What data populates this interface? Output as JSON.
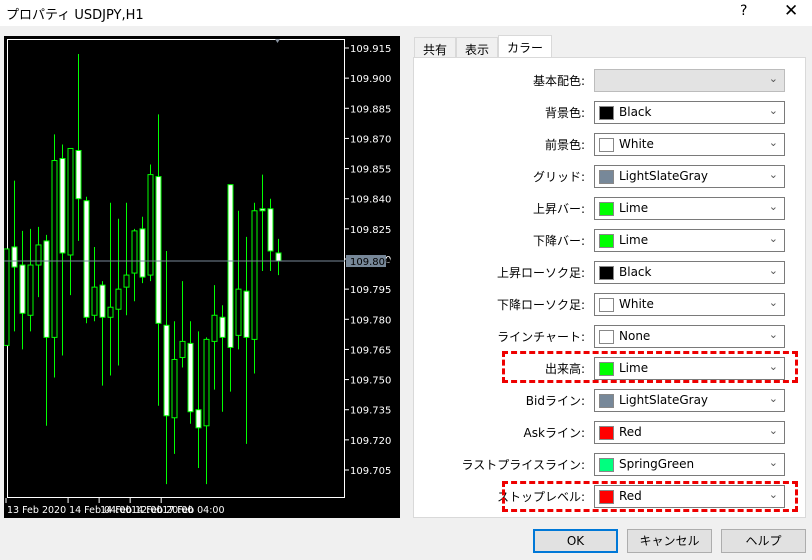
{
  "window": {
    "title": "プロパティ USDJPY,H1",
    "help_label": "?",
    "close_label": "✕"
  },
  "tabs": [
    {
      "label": "共有"
    },
    {
      "label": "表示"
    },
    {
      "label": "カラー",
      "active": true
    }
  ],
  "colors": {
    "rows": [
      {
        "label": "基本配色:",
        "value": "",
        "swatch": null,
        "disabled": true
      },
      {
        "label": "背景色:",
        "value": "Black",
        "swatch": "#000000"
      },
      {
        "label": "前景色:",
        "value": "White",
        "swatch": "#ffffff"
      },
      {
        "label": "グリッド:",
        "value": "LightSlateGray",
        "swatch": "#778899"
      },
      {
        "label": "上昇バー:",
        "value": "Lime",
        "swatch": "#00ff00"
      },
      {
        "label": "下降バー:",
        "value": "Lime",
        "swatch": "#00ff00"
      },
      {
        "label": "上昇ローソク足:",
        "value": "Black",
        "swatch": "#000000"
      },
      {
        "label": "下降ローソク足:",
        "value": "White",
        "swatch": "#ffffff"
      },
      {
        "label": "ラインチャート:",
        "value": "None",
        "swatch": "#ffffff"
      },
      {
        "label": "出来高:",
        "value": "Lime",
        "swatch": "#00ff00",
        "highlighted": true
      },
      {
        "label": "Bidライン:",
        "value": "LightSlateGray",
        "swatch": "#778899"
      },
      {
        "label": "Askライン:",
        "value": "Red",
        "swatch": "#ff0000"
      },
      {
        "label": "ラストプライスライン:",
        "value": "SpringGreen",
        "swatch": "#00ff7f"
      },
      {
        "label": "ストップレベル:",
        "value": "Red",
        "swatch": "#ff0000",
        "highlighted": true
      }
    ]
  },
  "buttons": {
    "ok": "OK",
    "cancel": "キャンセル",
    "help": "ヘルプ"
  },
  "chart_data": {
    "type": "candlestick",
    "symbol": "USDJPY",
    "timeframe": "H1",
    "ylim": [
      109.6975,
      109.9165
    ],
    "y_ticks": [
      "109.915",
      "109.900",
      "109.885",
      "109.870",
      "109.855",
      "109.840",
      "109.825",
      "109.810",
      "109.795",
      "109.780",
      "109.765",
      "109.750",
      "109.735",
      "109.720",
      "109.705"
    ],
    "x_ticks": [
      {
        "label": "13 Feb 2020",
        "index": 0
      },
      {
        "label": "14 Feb 04:00",
        "index": 16
      },
      {
        "label": "14 Feb 12:00",
        "index": 24
      },
      {
        "label": "14 Feb 20:00",
        "index": 32
      },
      {
        "label": "17 Feb 04:00",
        "index": 40
      }
    ],
    "current_price": "109.809",
    "colors": {
      "bar": "#00ff00",
      "bull_body": "#000000",
      "bear_body": "#ffffff",
      "bid_line": "#778899",
      "foreground": "#ffffff"
    },
    "ohlc": [
      [
        109.767,
        109.815,
        109.767,
        109.815
      ],
      [
        109.816,
        109.849,
        109.774,
        109.806
      ],
      [
        109.807,
        109.824,
        109.765,
        109.783
      ],
      [
        109.782,
        109.825,
        109.774,
        109.807
      ],
      [
        109.807,
        109.826,
        109.791,
        109.817
      ],
      [
        109.819,
        109.822,
        109.727,
        109.771
      ],
      [
        109.771,
        109.872,
        109.751,
        109.859
      ],
      [
        109.86,
        109.867,
        109.762,
        109.813
      ],
      [
        109.812,
        109.865,
        109.792,
        109.865
      ],
      [
        109.864,
        109.912,
        109.819,
        109.84
      ],
      [
        109.839,
        109.841,
        109.778,
        109.781
      ],
      [
        109.782,
        109.816,
        109.779,
        109.796
      ],
      [
        109.797,
        109.799,
        109.747,
        109.781
      ],
      [
        109.781,
        109.838,
        109.752,
        109.786
      ],
      [
        109.785,
        109.83,
        109.757,
        109.795
      ],
      [
        109.796,
        109.838,
        109.782,
        109.802
      ],
      [
        109.803,
        109.825,
        109.789,
        109.824
      ],
      [
        109.825,
        109.831,
        109.798,
        109.801
      ],
      [
        109.802,
        109.857,
        109.799,
        109.852
      ],
      [
        109.851,
        109.882,
        109.737,
        109.778
      ],
      [
        109.777,
        109.814,
        109.698,
        109.732
      ],
      [
        109.731,
        109.779,
        109.713,
        109.76
      ],
      [
        109.761,
        109.799,
        109.756,
        109.769
      ],
      [
        109.768,
        109.779,
        109.728,
        109.734
      ],
      [
        109.735,
        109.774,
        109.706,
        109.726
      ],
      [
        109.727,
        109.771,
        109.698,
        109.77
      ],
      [
        109.769,
        109.797,
        109.745,
        109.782
      ],
      [
        109.781,
        109.787,
        109.734,
        109.771
      ],
      [
        109.847,
        109.847,
        109.744,
        109.766
      ],
      [
        109.772,
        109.834,
        109.765,
        109.795
      ],
      [
        109.794,
        109.821,
        109.718,
        109.771
      ],
      [
        109.77,
        109.838,
        109.753,
        109.834
      ],
      [
        109.835,
        109.852,
        109.804,
        109.834
      ],
      [
        109.835,
        109.84,
        109.804,
        109.814
      ],
      [
        109.813,
        109.82,
        109.802,
        109.809
      ]
    ]
  }
}
